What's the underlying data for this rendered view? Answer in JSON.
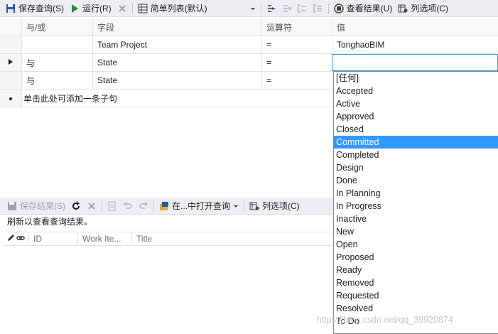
{
  "query_toolbar": {
    "save_query_label": "保存查询(S)",
    "run_label": "运行(R)",
    "view_mode_label": "简单列表(默认)",
    "view_results_label": "查看结果(U)",
    "column_options_label": "列选项(C)"
  },
  "clause_grid": {
    "headers": {
      "and_or": "与/或",
      "field": "字段",
      "operator": "运算符",
      "value": "值"
    },
    "rows": [
      {
        "and_or": "",
        "field": "Team Project",
        "operator": "=",
        "value": "TonghaoBIM"
      },
      {
        "and_or": "与",
        "field": "State",
        "operator": "=",
        "value": ""
      },
      {
        "and_or": "与",
        "field": "State",
        "operator": "=",
        "value": ""
      }
    ],
    "add_clause_label": "单击此处可添加一条子句"
  },
  "value_dropdown": {
    "items": [
      "[任何]",
      "Accepted",
      "Active",
      "Approved",
      "Closed",
      "Committed",
      "Completed",
      "Design",
      "Done",
      "In Planning",
      "In Progress",
      "Inactive",
      "New",
      "Open",
      "Proposed",
      "Ready",
      "Removed",
      "Requested",
      "Resolved",
      "To Do"
    ],
    "selected": "Committed"
  },
  "results_toolbar": {
    "save_results_label": "保存结果(S)",
    "open_in_label": "在...中打开查询",
    "column_options_label": "列选项(C)"
  },
  "results": {
    "status": "刷新以查看查询结果。",
    "columns": [
      "ID",
      "Work Ite...",
      "Title"
    ]
  },
  "watermark": "https://blog.csdn.net/qq_39920874",
  "colors": {
    "accent": "#3399ff",
    "toolbar_bg": "#eeeef2",
    "run_green": "#1f8f3c",
    "icon_blue": "#1e5aa8"
  }
}
